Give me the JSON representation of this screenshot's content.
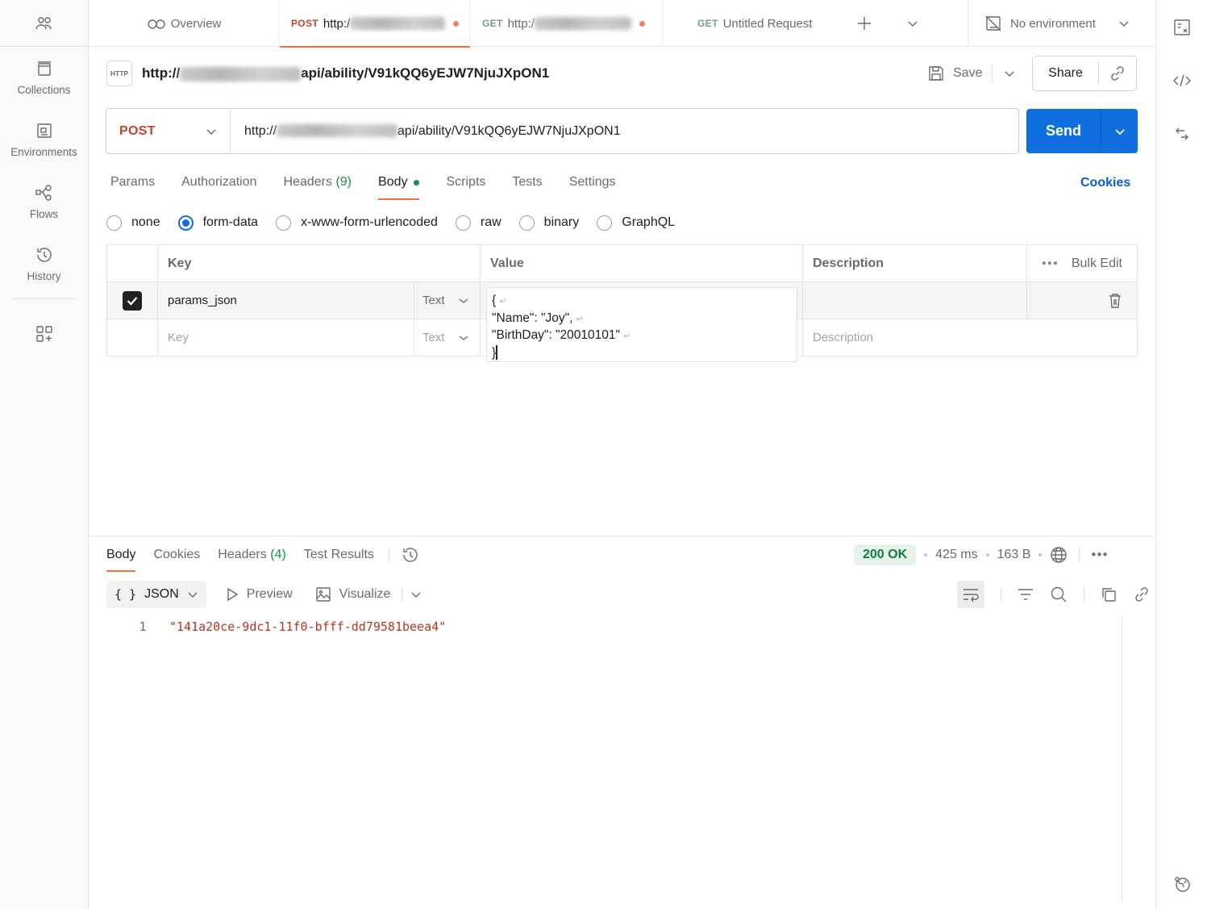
{
  "sidebar": {
    "items": [
      {
        "label": "Collections",
        "icon": "collections-icon"
      },
      {
        "label": "Environments",
        "icon": "environments-icon"
      },
      {
        "label": "Flows",
        "icon": "flows-icon"
      },
      {
        "label": "History",
        "icon": "history-icon"
      }
    ]
  },
  "tabs": {
    "overview": "Overview",
    "tab1_method": "POST",
    "tab1_url": "http:/",
    "tab2_method": "GET",
    "tab2_url": "http:/",
    "tab3_method": "GET",
    "tab3_title": "Untitled Request",
    "environment": "No environment"
  },
  "request": {
    "title_prefix": "http://",
    "title_suffix": "api/ability/V91kQQ6yEJW7NjuJXpON1",
    "save_label": "Save",
    "share_label": "Share",
    "method": "POST",
    "url_prefix": "http://",
    "url_suffix": "api/ability/V91kQQ6yEJW7NjuJXpON1",
    "send_label": "Send",
    "tabs": {
      "params": "Params",
      "authorization": "Authorization",
      "headers": "Headers",
      "headers_count": "(9)",
      "body": "Body",
      "scripts": "Scripts",
      "tests": "Tests",
      "settings": "Settings"
    },
    "cookies_link": "Cookies",
    "body_types": [
      "none",
      "form-data",
      "x-www-form-urlencoded",
      "raw",
      "binary",
      "GraphQL"
    ],
    "selected_body_type": "form-data"
  },
  "table": {
    "headers": {
      "key": "Key",
      "value": "Value",
      "description": "Description",
      "bulk_edit": "Bulk Edit"
    },
    "row1": {
      "key": "params_json",
      "type": "Text"
    },
    "new_row": {
      "key_placeholder": "Key",
      "type": "Text",
      "description_placeholder": "Description"
    },
    "value_lines": [
      "{",
      "\"Name\": \"Joy\",",
      "\"BirthDay\": \"20010101\"",
      "}"
    ]
  },
  "response": {
    "tabs": {
      "body": "Body",
      "cookies": "Cookies",
      "headers": "Headers",
      "headers_count": "(4)",
      "test_results": "Test Results"
    },
    "status": "200 OK",
    "time": "425 ms",
    "size": "163 B",
    "format": "JSON",
    "preview": "Preview",
    "visualize": "Visualize",
    "line_number": "1",
    "body_line": "\"141a20ce-9dc1-11f0-bfff-dd79581beea4\""
  },
  "colors": {
    "accent": "#ff6c37",
    "send_blue": "#0f6fde",
    "post_method": "#c2442b",
    "status_green": "#157a3c"
  }
}
